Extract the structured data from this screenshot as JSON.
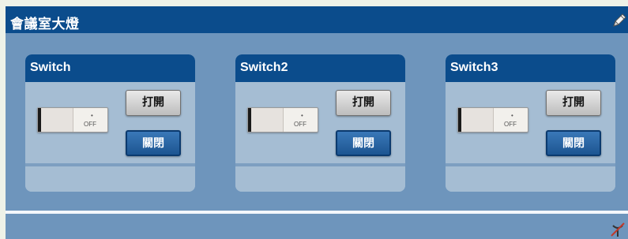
{
  "page": {
    "title": "會議室大燈",
    "edit_icon": "pencil-icon",
    "status_icon": "antenna-crossed-icon"
  },
  "panels": [
    {
      "title": "Switch",
      "toggle": {
        "state": "OFF",
        "dot": "•"
      },
      "open_label": "打開",
      "close_label": "關閉"
    },
    {
      "title": "Switch2",
      "toggle": {
        "state": "OFF",
        "dot": "•"
      },
      "open_label": "打開",
      "close_label": "關閉"
    },
    {
      "title": "Switch3",
      "toggle": {
        "state": "OFF",
        "dot": "•"
      },
      "open_label": "打開",
      "close_label": "關閉"
    }
  ],
  "colors": {
    "header": "#0b4c8c",
    "frame": "#6e95bc",
    "panel": "#a5bdd3",
    "close_button": "#1c5591",
    "open_button": "#c9c9c9"
  }
}
